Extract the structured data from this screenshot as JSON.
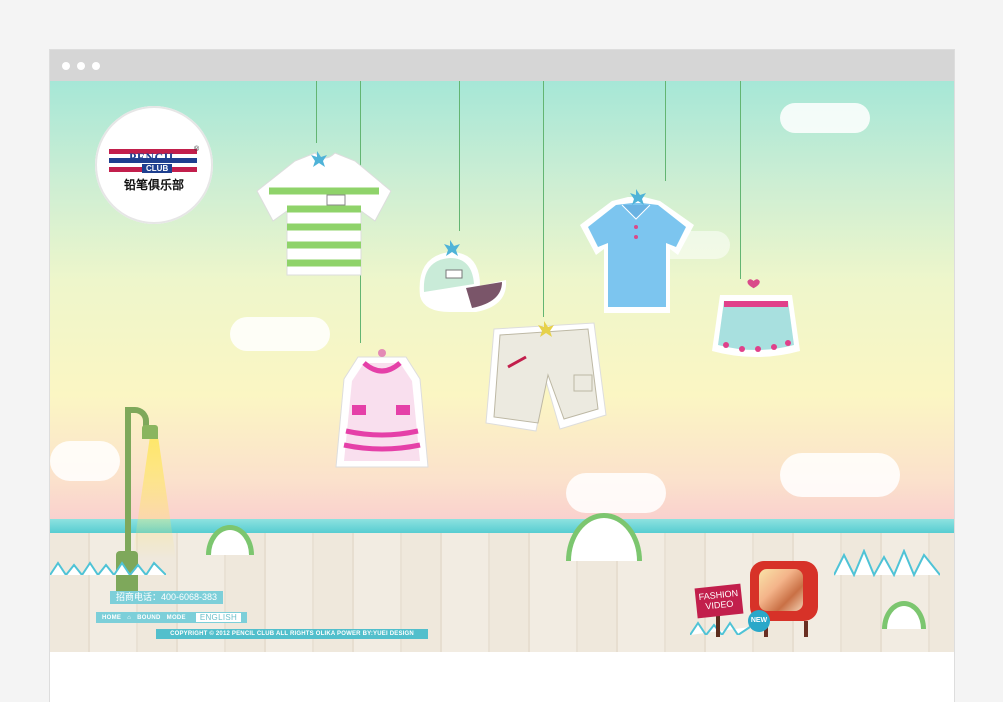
{
  "browser": {
    "title_dots": 3
  },
  "logo": {
    "brand": "PENCIL",
    "sub": "CLUB",
    "registered": "®",
    "chinese": "铅笔俱乐部"
  },
  "footer": {
    "phone": "招商电话：400-6068-383",
    "nav": [
      "HOME",
      "BOUND",
      "MODE"
    ],
    "english": "ENGLISH",
    "copyright": "COPYRIGHT © 2012 PENCIL CLUB ALL RIGHTS OLIKA POWER BY:YUEI DESIGN"
  },
  "promo": {
    "sign": "FASHION VIDEO",
    "badge": "NEW"
  },
  "colors": {
    "accent": "#57cdd2",
    "brand_red": "#c21f4c",
    "brand_blue": "#1e3f8f"
  },
  "icons": [
    "home-icon",
    "star-icon",
    "tv-icon"
  ]
}
